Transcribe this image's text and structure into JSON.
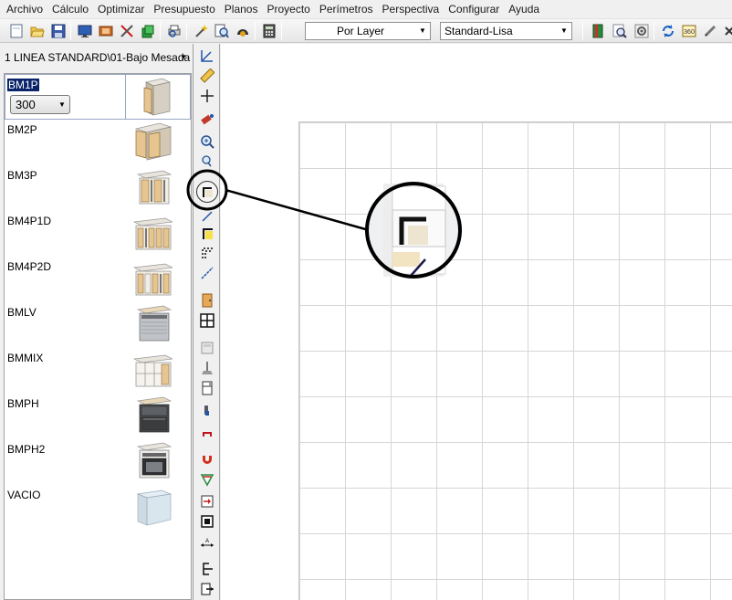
{
  "menu": [
    "Archivo",
    "Cálculo",
    "Optimizar",
    "Presupuesto",
    "Planos",
    "Proyecto",
    "Perímetros",
    "Perspectiva",
    "Configurar",
    "Ayuda"
  ],
  "toolbar": {
    "layer_combo": "Por Layer",
    "style_combo": "Standard-Lisa",
    "icons": [
      "new-document-icon",
      "open-folder-icon",
      "save-icon",
      "monitor-icon",
      "render-icon",
      "tools-icon",
      "layers-icon",
      "print-preview-icon",
      "magic-wand-icon",
      "zoom-page-icon",
      "camera-icon",
      "calculator-icon",
      "book-icon",
      "zoom-icon",
      "settings-icon",
      "refresh-icon",
      "rotate-360-icon",
      "pencil-icon",
      "close-icon"
    ]
  },
  "left_panel": {
    "catalog": "1 LINEA STANDARD\\01-Bajo Mesada",
    "selected_size": "300",
    "modules": [
      {
        "name": "BM1P",
        "thumb": "cabinet-1-door"
      },
      {
        "name": "BM2P",
        "thumb": "cabinet-2-doors"
      },
      {
        "name": "BM3P",
        "thumb": "cabinet-3-doors"
      },
      {
        "name": "BM4P1D",
        "thumb": "cabinet-4-doors-drawer"
      },
      {
        "name": "BM4P2D",
        "thumb": "cabinet-4-doors-2-drawers"
      },
      {
        "name": "BMLV",
        "thumb": "dishwasher-cabinet"
      },
      {
        "name": "BMMIX",
        "thumb": "open-shelf-cabinet"
      },
      {
        "name": "BMPH",
        "thumb": "oven-cabinet-dark"
      },
      {
        "name": "BMPH2",
        "thumb": "oven-cabinet"
      },
      {
        "name": "VACIO",
        "thumb": "empty-box"
      }
    ]
  },
  "vertical_toolbar": [
    "measure-angle-icon",
    "ruler-icon",
    "crosshair-icon",
    "paint-icon",
    "zoom-in-icon",
    "zoom-extents-icon",
    "corner-wall-icon",
    "pen-icon",
    "corner-wall-yellow-icon",
    "dashed-corner-icon",
    "line-icon",
    "door-icon",
    "window-icon",
    "hood-icon",
    "lamp-icon",
    "fridge-icon",
    "person-icon",
    "chair-icon",
    "magnet-icon",
    "snap-icon",
    "insert-icon",
    "frame-icon",
    "dimension-icon",
    "undo-icon",
    "export-icon"
  ],
  "colors": {
    "selection": "#0a246a",
    "grid_line": "#d6d6d6",
    "wood": "#e8c99a",
    "panel": "#f0f0f0"
  }
}
